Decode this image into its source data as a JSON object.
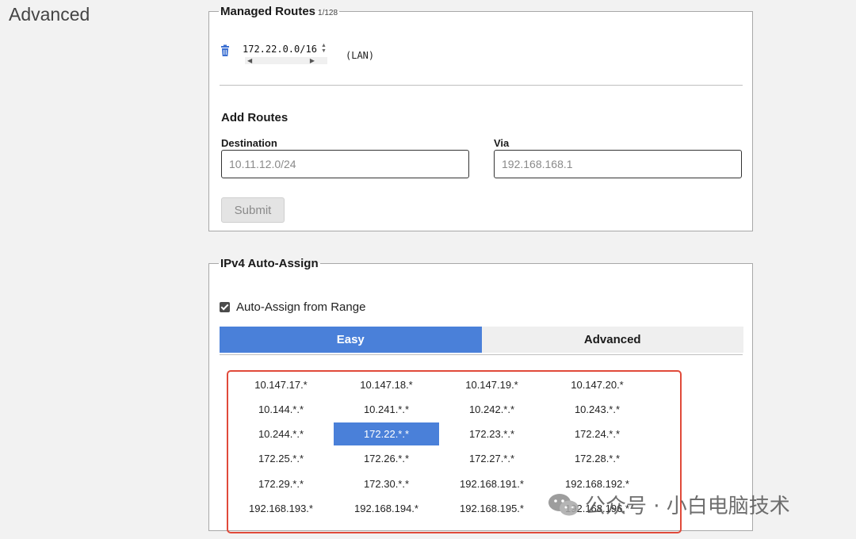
{
  "section": {
    "heading": "Advanced"
  },
  "managed_routes": {
    "legend": "Managed Routes",
    "count": "1/128",
    "routes": [
      {
        "network": "172.22.0.0/16",
        "via_label": "(LAN)"
      }
    ],
    "add": {
      "heading": "Add Routes",
      "destination_label": "Destination",
      "destination_placeholder": "10.11.12.0/24",
      "via_label": "Via",
      "via_placeholder": "192.168.168.1",
      "submit_label": "Submit"
    }
  },
  "ipv4_auto_assign": {
    "legend": "IPv4 Auto-Assign",
    "checkbox_label": "Auto-Assign from Range",
    "checked": true,
    "tabs": [
      {
        "label": "Easy",
        "active": true
      },
      {
        "label": "Advanced",
        "active": false
      }
    ],
    "ranges": [
      [
        "10.147.17.*",
        "10.147.18.*",
        "10.147.19.*",
        "10.147.20.*"
      ],
      [
        "10.144.*.*",
        "10.241.*.*",
        "10.242.*.*",
        "10.243.*.*"
      ],
      [
        "10.244.*.*",
        "172.22.*.*",
        "172.23.*.*",
        "172.24.*.*"
      ],
      [
        "172.25.*.*",
        "172.26.*.*",
        "172.27.*.*",
        "172.28.*.*"
      ],
      [
        "172.29.*.*",
        "172.30.*.*",
        "192.168.191.*",
        "192.168.192.*"
      ],
      [
        "192.168.193.*",
        "192.168.194.*",
        "192.168.195.*",
        "192.168.196.*"
      ]
    ],
    "selected_range": "172.22.*.*"
  },
  "watermark": {
    "text": "公众号 · 小白电脑技术"
  },
  "colors": {
    "accent": "#4a80d9",
    "highlight_border": "#e04a3a",
    "trash_icon": "#3b6fd1"
  }
}
